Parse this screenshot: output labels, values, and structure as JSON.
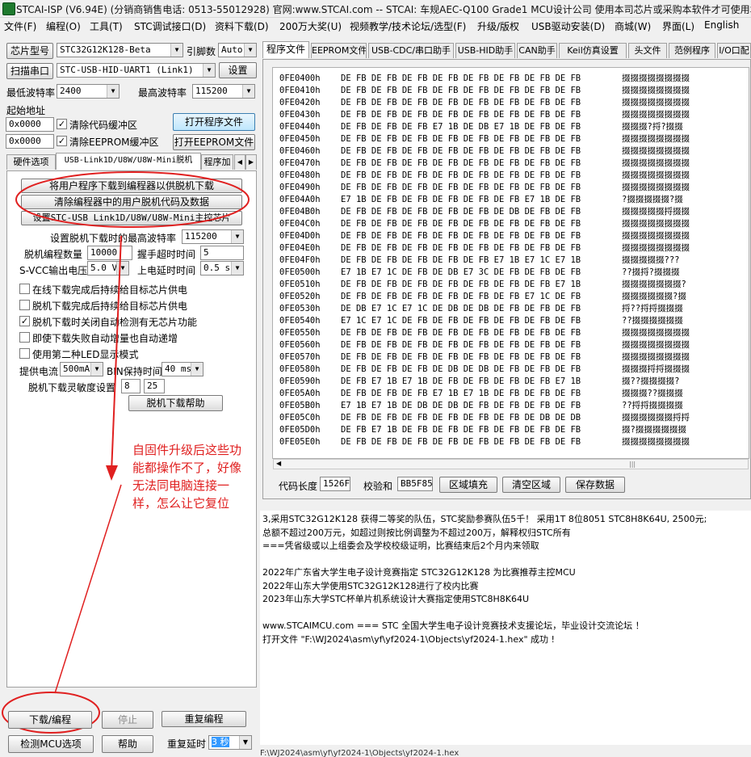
{
  "title": "STCAI-ISP (V6.94E) (分销商销售电话: 0513-55012928) 官网:www.STCAI.com  -- STCAI: 车规AEC-Q100 Grade1 MCU设计公司 使用本司芯片或采购本软件才可使用本软件",
  "menu": [
    "文件(F)",
    "编程(O)",
    "工具(T)",
    "STC调试接口(D)",
    "资料下载(D)",
    "200万大奖(U)",
    "视频教学/技术论坛/选型(F)",
    "升级/版权",
    "USB驱动安装(D)",
    "商城(W)",
    "界面(L)",
    "English"
  ],
  "left": {
    "chip_label": "芯片型号",
    "chip_value": "STC32G12K128-Beta",
    "pins_label": "引脚数",
    "pins_value": "Auto",
    "scan_button": "扫描串口",
    "port_value": "STC-USB-HID-UART1 (Link1)",
    "settings_button": "设置",
    "min_baud_label": "最低波特率",
    "min_baud_value": "2400",
    "max_baud_label": "最高波特率",
    "max_baud_value": "115200",
    "start_addr_label": "起始地址",
    "addr1": "0x0000",
    "clear_code_label": "清除代码缓冲区",
    "open_prog_button": "打开程序文件",
    "addr2": "0x0000",
    "clear_eeprom_label": "清除EEPROM缓冲区",
    "open_eeprom_button": "打开EEPROM文件",
    "tabs": [
      "硬件选项",
      "USB-Link1D/U8W/U8W-Mini脱机",
      "程序加"
    ],
    "btn_download_to_programmer": "将用户程序下载到编程器以供脱机下载",
    "btn_clear_programmer": "清除编程器中的用户脱机代码及数据",
    "btn_set_master": "设置STC-USB Link1D/U8W/U8W-Mini主控芯片",
    "offline_baud_label": "设置脱机下载时的最高波特率",
    "offline_baud_value": "115200",
    "prog_count_label": "脱机编程数量",
    "prog_count_value": "10000",
    "handshake_label": "握手超时时间",
    "handshake_value": "5",
    "svcc_label": "S-VCC输出电压",
    "svcc_value": "5.0 V",
    "power_delay_label": "上电延时时间",
    "power_delay_value": "0.5 s",
    "options": [
      {
        "label": "在线下载完成后持续给目标芯片供电",
        "checked": false
      },
      {
        "label": "脱机下载完成后持续给目标芯片供电",
        "checked": false
      },
      {
        "label": "脱机下载时关闭自动检测有无芯片功能",
        "checked": true
      },
      {
        "label": "即使下载失败自动增量也自动递增",
        "checked": false
      },
      {
        "label": "使用第二种LED显示模式",
        "checked": false
      }
    ],
    "current_label": "提供电流",
    "current_value": "500mA",
    "bin_hold_label": "BIN保持时间",
    "bin_hold_value": "40 ms",
    "sensitivity_label": "脱机下载灵敏度设置",
    "sens1": "8",
    "sens2": "25",
    "help_offline_button": "脱机下载帮助",
    "annotation": "自固件升级后这些功能都操作不了，好像无法同电脑连接一样，怎么让它复位",
    "download_button": "下载/编程",
    "stop_button": "停止",
    "reprogram_button": "重复编程",
    "detect_button": "检测MCU选项",
    "help_button": "帮助",
    "repeat_delay_label": "重复延时",
    "repeat_delay_value": "3 秒"
  },
  "right": {
    "tabs": [
      "程序文件",
      "EEPROM文件",
      "USB-CDC/串口助手",
      "USB-HID助手",
      "CAN助手",
      "Keil仿真设置",
      "头文件",
      "范例程序",
      "I/O口配"
    ],
    "hex_rows": [
      {
        "addr": "0FE0400h",
        "bytes": "DE FB DE FB DE FB DE FB DE FB DE FB DE FB DE FB",
        "ascii": "掇掇掇掇掇掇掇掇"
      },
      {
        "addr": "0FE0410h",
        "bytes": "DE FB DE FB DE FB DE FB DE FB DE FB DE FB DE FB",
        "ascii": "掇掇掇掇掇掇掇掇"
      },
      {
        "addr": "0FE0420h",
        "bytes": "DE FB DE FB DE FB DE FB DE FB DE FB DE FB DE FB",
        "ascii": "掇掇掇掇掇掇掇掇"
      },
      {
        "addr": "0FE0430h",
        "bytes": "DE FB DE FB DE FB DE FB DE FB DE FB DE FB DE FB",
        "ascii": "掇掇掇掇掇掇掇掇"
      },
      {
        "addr": "0FE0440h",
        "bytes": "DE FB DE FB DE FB E7 1B DE DB E7 1B DE FB DE FB",
        "ascii": "掇掇掇?捋?掇掇"
      },
      {
        "addr": "0FE0450h",
        "bytes": "DE FB DE FB DE FB DE FB DE FB DE FB DE FB DE FB",
        "ascii": "掇掇掇掇掇掇掇掇"
      },
      {
        "addr": "0FE0460h",
        "bytes": "DE FB DE FB DE FB DE FB DE FB DE FB DE FB DE FB",
        "ascii": "掇掇掇掇掇掇掇掇"
      },
      {
        "addr": "0FE0470h",
        "bytes": "DE FB DE FB DE FB DE FB DE FB DE FB DE FB DE FB",
        "ascii": "掇掇掇掇掇掇掇掇"
      },
      {
        "addr": "0FE0480h",
        "bytes": "DE FB DE FB DE FB DE FB DE FB DE FB DE FB DE FB",
        "ascii": "掇掇掇掇掇掇掇掇"
      },
      {
        "addr": "0FE0490h",
        "bytes": "DE FB DE FB DE FB DE FB DE FB DE FB DE FB DE FB",
        "ascii": "掇掇掇掇掇掇掇掇"
      },
      {
        "addr": "0FE04A0h",
        "bytes": "E7 1B DE FB DE FB DE FB DE FB DE FB E7 1B DE FB",
        "ascii": "?掇掇掇掇掇?掇"
      },
      {
        "addr": "0FE04B0h",
        "bytes": "DE FB DE FB DE FB DE FB DE FB DE DB DE FB DE FB",
        "ascii": "掇掇掇掇掇捋掇掇"
      },
      {
        "addr": "0FE04C0h",
        "bytes": "DE FB DE FB DE FB DE FB DE FB DE FB DE FB DE FB",
        "ascii": "掇掇掇掇掇掇掇掇"
      },
      {
        "addr": "0FE04D0h",
        "bytes": "DE FB DE FB DE FB DE FB DE FB DE FB DE FB DE FB",
        "ascii": "掇掇掇掇掇掇掇掇"
      },
      {
        "addr": "0FE04E0h",
        "bytes": "DE FB DE FB DE FB DE FB DE FB DE FB DE FB DE FB",
        "ascii": "掇掇掇掇掇掇掇掇"
      },
      {
        "addr": "0FE04F0h",
        "bytes": "DE FB DE FB DE FB DE FB DE FB E7 1B E7 1C E7 1B",
        "ascii": "掇掇掇掇掇???"
      },
      {
        "addr": "0FE0500h",
        "bytes": "E7 1B E7 1C DE FB DE DB E7 3C DE FB DE FB DE FB",
        "ascii": "??掇捋?掇掇掇"
      },
      {
        "addr": "0FE0510h",
        "bytes": "DE FB DE FB DE FB DE FB DE FB DE FB DE FB E7 1B",
        "ascii": "掇掇掇掇掇掇掇?"
      },
      {
        "addr": "0FE0520h",
        "bytes": "DE FB DE FB DE FB DE FB DE FB DE FB E7 1C DE FB",
        "ascii": "掇掇掇掇掇掇?掇"
      },
      {
        "addr": "0FE0530h",
        "bytes": "DE DB E7 1C E7 1C DE DB DE DB DE FB DE FB DE FB",
        "ascii": "捋??捋捋掇掇掇"
      },
      {
        "addr": "0FE0540h",
        "bytes": "E7 1C E7 1C DE FB DE FB DE FB DE FB DE FB DE FB",
        "ascii": "??掇掇掇掇掇掇"
      },
      {
        "addr": "0FE0550h",
        "bytes": "DE FB DE FB DE FB DE FB DE FB DE FB DE FB DE FB",
        "ascii": "掇掇掇掇掇掇掇掇"
      },
      {
        "addr": "0FE0560h",
        "bytes": "DE FB DE FB DE FB DE FB DE FB DE FB DE FB DE FB",
        "ascii": "掇掇掇掇掇掇掇掇"
      },
      {
        "addr": "0FE0570h",
        "bytes": "DE FB DE FB DE FB DE FB DE FB DE FB DE FB DE FB",
        "ascii": "掇掇掇掇掇掇掇掇"
      },
      {
        "addr": "0FE0580h",
        "bytes": "DE FB DE FB DE FB DE DB DE DB DE FB DE FB DE FB",
        "ascii": "掇掇掇捋捋掇掇掇"
      },
      {
        "addr": "0FE0590h",
        "bytes": "DE FB E7 1B E7 1B DE FB DE FB DE FB DE FB E7 1B",
        "ascii": "掇??掇掇掇掇?"
      },
      {
        "addr": "0FE05A0h",
        "bytes": "DE FB DE FB DE FB E7 1B E7 1B DE FB DE FB DE FB",
        "ascii": "掇掇掇??掇掇掇"
      },
      {
        "addr": "0FE05B0h",
        "bytes": "E7 1B E7 1B DE DB DE DB DE FB DE FB DE FB DE FB",
        "ascii": "??捋捋掇掇掇掇"
      },
      {
        "addr": "0FE05C0h",
        "bytes": "DE FB DE FB DE FB DE FB DE FB DE FB DE DB DE DB",
        "ascii": "掇掇掇掇掇掇捋捋"
      },
      {
        "addr": "0FE05D0h",
        "bytes": "DE FB E7 1B DE FB DE FB DE FB DE FB DE FB DE FB",
        "ascii": "掇?掇掇掇掇掇掇"
      },
      {
        "addr": "0FE05E0h",
        "bytes": "DE FB DE FB DE FB DE FB DE FB DE FB DE FB DE FB",
        "ascii": "掇掇掇掇掇掇掇掇"
      }
    ],
    "code_len_label": "代码长度",
    "code_len_value": "1526F",
    "checksum_label": "校验和",
    "checksum_value": "BB5F85",
    "fill_button": "区域填充",
    "clear_button": "清空区域",
    "save_button": "保存数据",
    "log_lines": [
      "3,采用STC32G12K128 获得二等奖的队伍，STC奖励参赛队伍5千！  采用1T 8位8051 STC8H8K64U, 2500元;",
      "总额不超过200万元，如超过则按比例调整为不超过200万，解释权归STC所有",
      "===凭省级或以上组委会及学校校级证明，比赛结束后2个月内来领取",
      "",
      "2022年广东省大学生电子设计竞赛指定 STC32G12K128 为比赛推荐主控MCU",
      "2022年山东大学使用STC32G12K128进行了校内比赛",
      "2023年山东大学STC杯单片机系统设计大赛指定使用STC8H8K64U",
      "",
      "www.STCAIMCU.com === STC 全国大学生电子设计竞赛技术支援论坛，毕业设计交流论坛 ！",
      "打开文件 \"F:\\WJ2024\\asm\\yf\\yf2024-1\\Objects\\yf2024-1.hex\" 成功 !"
    ],
    "status_path": "F:\\WJ2024\\asm\\yf\\yf2024-1\\Objects\\yf2024-1.hex"
  },
  "colors": {
    "annotation": "#e02020",
    "selected_blue": "#3399ff"
  }
}
